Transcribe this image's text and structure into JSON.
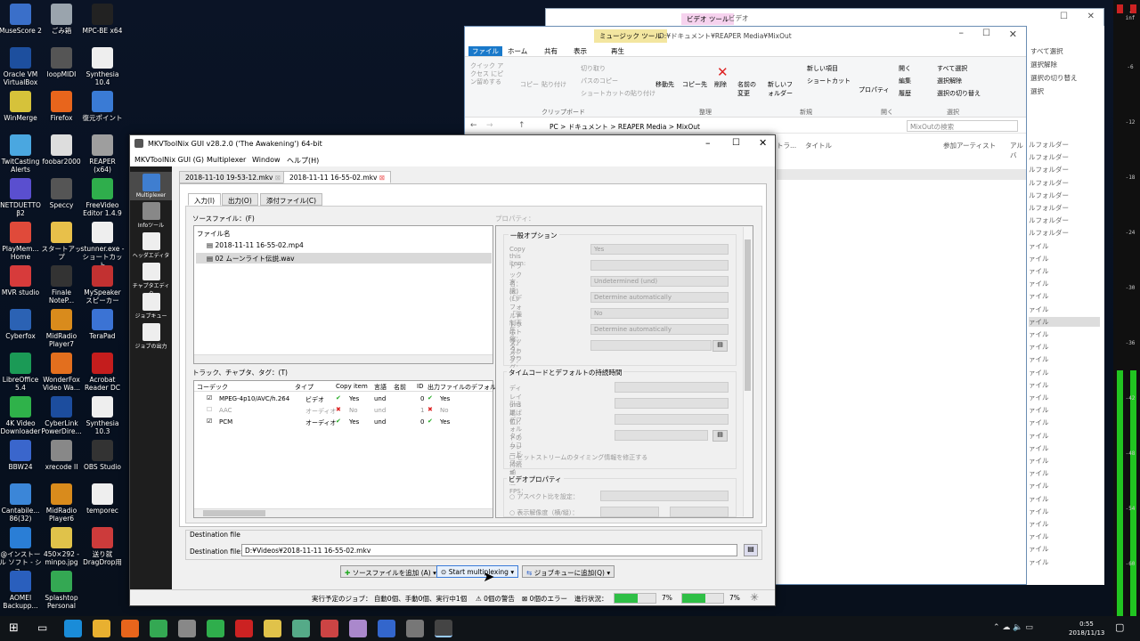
{
  "desktop_icons": [
    {
      "label": "MuseScore 2",
      "color": "#3a6fc9"
    },
    {
      "label": "ごみ箱",
      "color": "#9aa4ad"
    },
    {
      "label": "MPC-BE x64",
      "color": "#222222"
    },
    {
      "label": "Oracle VM VirtualBox",
      "color": "#1d4f9e"
    },
    {
      "label": "loopMIDI",
      "color": "#555555"
    },
    {
      "label": "Synthesia 10.4",
      "color": "#eeeeee"
    },
    {
      "label": "WinMerge",
      "color": "#d6c23a"
    },
    {
      "label": "Firefox",
      "color": "#e8651c"
    },
    {
      "label": "復元ポイント",
      "color": "#3a7bd5"
    },
    {
      "label": "TwitCasting Alerts",
      "color": "#4aa7e0"
    },
    {
      "label": "foobar2000",
      "color": "#dddddd"
    },
    {
      "label": "REAPER (x64)",
      "color": "#9e9e9e"
    },
    {
      "label": "NETDUETTO β2",
      "color": "#5a4fcf"
    },
    {
      "label": "Speccy",
      "color": "#555555"
    },
    {
      "label": "FreeVideo Editor 1.4.9",
      "color": "#2fae4c"
    },
    {
      "label": "PlayMem... Home",
      "color": "#e04a3a"
    },
    {
      "label": "スタートアップ",
      "color": "#e8c04a"
    },
    {
      "label": "stunner.exe - ショートカット",
      "color": "#eeeeee"
    },
    {
      "label": "MVR studio",
      "color": "#d73b3b"
    },
    {
      "label": "Finale NoteP...",
      "color": "#333333"
    },
    {
      "label": "MySpeaker スピーカー",
      "color": "#c23131"
    },
    {
      "label": "Cyberfox",
      "color": "#2b62b4"
    },
    {
      "label": "MidRadio Player7",
      "color": "#d98b1c"
    },
    {
      "label": "TeraPad",
      "color": "#3b73d4"
    },
    {
      "label": "LibreOffice 5.4",
      "color": "#1b9a56"
    },
    {
      "label": "WonderFox Video Wa...",
      "color": "#e36f1e"
    },
    {
      "label": "Acrobat Reader DC",
      "color": "#c41d1d"
    },
    {
      "label": "4K Video Downloader",
      "color": "#2fb24a"
    },
    {
      "label": "CyberLink PowerDire...",
      "color": "#1c4d9e"
    },
    {
      "label": "Synthesia 10.3",
      "color": "#eeeeee"
    },
    {
      "label": "BBW24",
      "color": "#3a66cc"
    },
    {
      "label": "xrecode II",
      "color": "#888888"
    },
    {
      "label": "OBS Studio",
      "color": "#333333"
    },
    {
      "label": "Cantabile... 86(32)",
      "color": "#3b86d8"
    },
    {
      "label": "MidRadio Player6",
      "color": "#d98b1c"
    },
    {
      "label": "temporec",
      "color": "#eeeeee"
    },
    {
      "label": "@インストール ソフト - ショ...",
      "color": "#2a7ed6"
    },
    {
      "label": "450×292 - minpo.jpg",
      "color": "#e0c24a"
    },
    {
      "label": "送り就 DragDrop用",
      "color": "#cc3b3b"
    },
    {
      "label": "AOMEI Backupp...",
      "color": "#2a5fbd"
    },
    {
      "label": "Splashtop Personal",
      "color": "#34a853"
    }
  ],
  "explorer": {
    "title": "D:¥ドキュメント¥REAPER Media¥MixOut",
    "tab_highlight": "ミュージック ツール",
    "menu": [
      "ファイル",
      "ホーム",
      "共有",
      "表示",
      "再生"
    ],
    "ribbon": [
      "切り取り",
      "パスのコピー",
      "ショートカットの貼り付け",
      "移動先",
      "コピー先",
      "削除",
      "名前の変更",
      "新しいフォルダー",
      "新しい項目",
      "ショートカット",
      "プロパティ",
      "開く",
      "編集",
      "履歴",
      "すべて選択",
      "選択解除",
      "選択の切り替え"
    ],
    "ribbon_groups": [
      "クリップボード",
      "整理",
      "新規",
      "開く",
      "選択"
    ],
    "clip_buttons": [
      "クイック アクセス にピン留めする",
      "コピー",
      "貼り付け"
    ],
    "path": "PC > ドキュメント > REAPER Media > MixOut",
    "search_placeholder": "MixOutの検索",
    "columns": [
      "トラ...",
      "タイトル",
      "参加アーティスト",
      "アルバ"
    ],
    "back_title": "ビデオ ツール",
    "back_tab": "ビデオ"
  },
  "right_list": {
    "items": [
      "すべて選択",
      "選択解除",
      "選択の切り替え",
      "選択"
    ],
    "folders": [
      "ルフォルダー",
      "ルフォルダー",
      "ルフォルダー",
      "ルフォルダー",
      "ルフォルダー",
      "ルフォルダー",
      "ルフォルダー",
      "ルフォルダー",
      "ァイル",
      "ァイル",
      "ァイル",
      "ァイル",
      "ァイル",
      "ァイル",
      "ァイル",
      "ァイル",
      "ァイル",
      "ァイル",
      "ァイル",
      "ァイル",
      "ァイル",
      "ァイル",
      "ァイル",
      "ァイル",
      "ァイル",
      "ァイル",
      "ァイル",
      "ァイル",
      "ァイル",
      "ァイル",
      "ァイル",
      "ァイル",
      "ァイル",
      "ァイル"
    ]
  },
  "meter": {
    "labels": [
      "-inf",
      "-6",
      "-12",
      "-18",
      "-24",
      "-30",
      "-36",
      "-42",
      "-48",
      "-54",
      "-60"
    ],
    "level_left": 0.41,
    "level_right": 0.41
  },
  "mkv": {
    "title": "MKVToolNix GUI v28.2.0 ('The Awakening') 64-bit",
    "menu": [
      "MKVToolNix GUI (G)",
      "Multiplexer",
      "Window",
      "ヘルプ(H)"
    ],
    "sidebar": [
      "Multiplexer",
      "Infoツール",
      "ヘッダエディタ",
      "チャプタエディタ",
      "ジョブキュー",
      "ジョブの出力"
    ],
    "file_tabs": [
      "2018-11-10 19-53-12.mkv",
      "2018-11-11 16-55-02.mkv"
    ],
    "sub_tabs": [
      "入力(I)",
      "出力(O)",
      "添付ファイル(C)"
    ],
    "source_label": "ソースファイル：(F)",
    "file_header": "ファイル名",
    "files": [
      "2018-11-11 16-55-02.mp4",
      "02 ムーンライト伝説.wav"
    ],
    "tracks_label": "トラック、チャプタ、タグ：(T)",
    "track_headers": [
      "コーデック",
      "タイプ",
      "Copy item",
      "言語",
      "名前",
      "ID",
      "出力ファイルのデフォルト"
    ],
    "tracks": [
      {
        "codec": "MPEG-4p10/AVC/h.264",
        "type": "ビデオ",
        "copy": "Yes",
        "lang": "und",
        "id": "0",
        "def": "Yes",
        "checked": "☑"
      },
      {
        "codec": "AAC",
        "type": "オーディオ",
        "copy": "No",
        "lang": "und",
        "id": "1",
        "def": "No",
        "checked": "☐"
      },
      {
        "codec": "PCM",
        "type": "オーディオ",
        "copy": "Yes",
        "lang": "und",
        "id": "0",
        "def": "Yes",
        "checked": "☑"
      }
    ],
    "props_label": "プロパティ：",
    "general_group": "一般オプション",
    "general_rows": [
      {
        "label": "Copy this item:",
        "value": "Yes"
      },
      {
        "label": "トラック名：(K)",
        "value": ""
      },
      {
        "label": "言語：(L)",
        "value": "Undetermined (und)"
      },
      {
        "label": "「デフォルトトラック」フラグ：",
        "value": "Determine automatically"
      },
      {
        "label": "「強制表示トラック」フラグ：",
        "value": "No"
      },
      {
        "label": "圧縮：",
        "value": "Determine automatically"
      },
      {
        "label": "タグ：",
        "value": ""
      }
    ],
    "timecode_group": "タイムコードとデフォルトの持続時間",
    "timecode_rows": [
      "ディレイ(ms単位)：",
      "引き延ばし：",
      "デフォルトのフレーム持続期間・FPS：",
      "タイムコードファイル："
    ],
    "bitstream_check": "ビットストリームのタイミング情報を修正する",
    "video_group": "ビデオプロパティ",
    "video_rows": [
      "アスペクト比を設定：",
      "表示解像度（横/縦）："
    ],
    "dest_group": "Destination file",
    "dest_label": "Destination file:",
    "dest_value": "D:¥Videos¥2018-11-11 16-55-02.mkv",
    "btn_add": "ソースファイルを追加 (A)",
    "btn_start": "Start multiplexing",
    "btn_queue": "ジョブキューに追加(Q)",
    "status_jobs": "実行予定のジョブ：  自動0個、手動0個、実行中1個",
    "status_warn": "0個の警告",
    "status_err": "0個のエラー",
    "status_progress": "進行状況：",
    "progress_pct": "7%",
    "progress_pct2": "7%",
    "progress_value": 0.07
  },
  "taskbar": {
    "time": "0:55",
    "date": "2018/11/13"
  }
}
